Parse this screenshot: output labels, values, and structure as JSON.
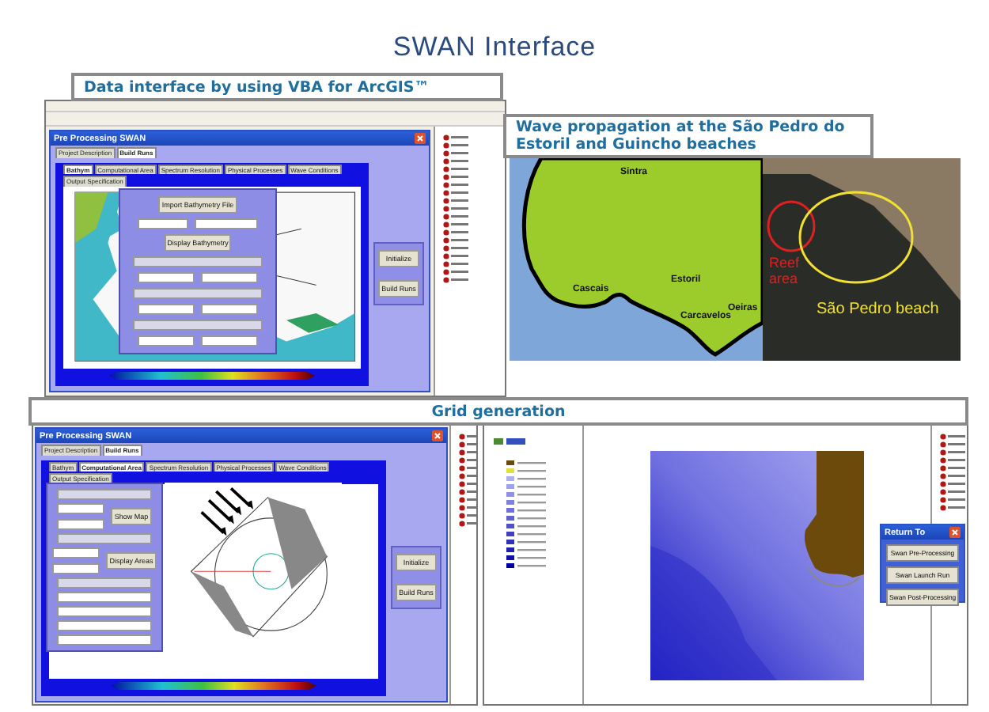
{
  "title": "SWAN Interface",
  "vba_section": {
    "caption": "Data interface by using VBA for ArcGIS™",
    "dialog": {
      "title": "Pre Processing SWAN",
      "outer_tabs": [
        {
          "label": "Project Description",
          "selected": false
        },
        {
          "label": "Build Runs",
          "selected": true
        }
      ],
      "tabs": [
        {
          "label": "Bathym",
          "selected": true
        },
        {
          "label": "Computational Area",
          "selected": false
        },
        {
          "label": "Spectrum Resolution",
          "selected": false
        },
        {
          "label": "Physical Processes",
          "selected": false
        },
        {
          "label": "Wave Conditions",
          "selected": false
        },
        {
          "label": "Output Specification",
          "selected": false
        }
      ],
      "panel_buttons": [
        "Import Bathymetry File",
        "Display Bathymetry"
      ],
      "side_buttons": [
        "Initialize",
        "Build Runs"
      ]
    }
  },
  "map_section": {
    "caption": "Wave propagation at the São Pedro do Estoril and Guincho beaches",
    "places": [
      "Sintra",
      "Estoril",
      "Cascais",
      "Carcavelos",
      "Oeiras"
    ],
    "photo_labels": [
      {
        "text": "Reef area",
        "color": "#e02020"
      },
      {
        "text": "São Pedro beach",
        "color": "#f0e030"
      }
    ]
  },
  "grid_section": {
    "caption": "Grid generation",
    "dialog": {
      "title": "Pre Processing SWAN",
      "outer_tabs": [
        {
          "label": "Project Description",
          "selected": false
        },
        {
          "label": "Build Runs",
          "selected": true
        }
      ],
      "tabs": [
        {
          "label": "Bathym",
          "selected": false
        },
        {
          "label": "Computational Area",
          "selected": true
        },
        {
          "label": "Spectrum Resolution",
          "selected": false
        },
        {
          "label": "Physical Processes",
          "selected": false
        },
        {
          "label": "Wave Conditions",
          "selected": false
        },
        {
          "label": "Output Specification",
          "selected": false
        }
      ],
      "panel_buttons": [
        "Show Map",
        "Display Areas"
      ],
      "side_buttons": [
        "Initialize",
        "Build Runs"
      ]
    },
    "return_dialog": {
      "title": "Return To",
      "buttons": [
        "Swan Pre-Processing",
        "Swan Launch Run",
        "Swan Post-Processing"
      ]
    }
  }
}
